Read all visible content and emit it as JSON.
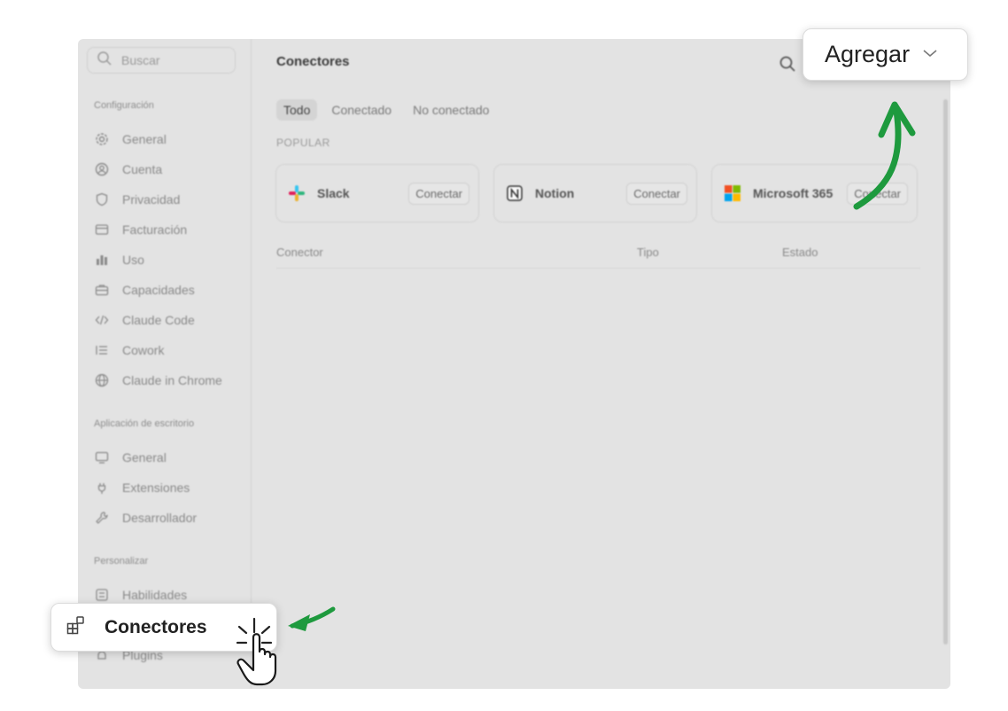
{
  "sidebar": {
    "search_placeholder": "Buscar",
    "sections": [
      {
        "label": "Configuración",
        "items": [
          {
            "label": "General",
            "icon": "gear-icon"
          },
          {
            "label": "Cuenta",
            "icon": "user-circle-icon"
          },
          {
            "label": "Privacidad",
            "icon": "shield-icon"
          },
          {
            "label": "Facturación",
            "icon": "credit-card-icon"
          },
          {
            "label": "Uso",
            "icon": "bar-chart-icon"
          },
          {
            "label": "Capacidades",
            "icon": "briefcase-icon"
          },
          {
            "label": "Claude Code",
            "icon": "code-icon"
          },
          {
            "label": "Cowork",
            "icon": "list-icon"
          },
          {
            "label": "Claude in Chrome",
            "icon": "globe-icon"
          }
        ]
      },
      {
        "label": "Aplicación de escritorio",
        "items": [
          {
            "label": "General",
            "icon": "monitor-icon"
          },
          {
            "label": "Extensiones",
            "icon": "plug-icon"
          },
          {
            "label": "Desarrollador",
            "icon": "wrench-icon"
          }
        ]
      },
      {
        "label": "Personalizar",
        "items": [
          {
            "label": "Habilidades",
            "icon": "skills-icon"
          },
          {
            "label": "Plugins",
            "icon": "plugin-icon"
          }
        ]
      }
    ]
  },
  "main": {
    "title": "Conectores",
    "tabs": [
      "Todo",
      "Conectado",
      "No conectado"
    ],
    "active_tab": "Todo",
    "popular_label": "POPULAR",
    "popular_cards": [
      {
        "name": "Slack",
        "button": "Conectar",
        "icon": "slack-logo-icon"
      },
      {
        "name": "Notion",
        "button": "Conectar",
        "icon": "notion-logo-icon"
      },
      {
        "name": "Microsoft 365",
        "button": "Conectar",
        "icon": "microsoft-logo-icon"
      }
    ],
    "table_columns": [
      "Conector",
      "Tipo",
      "Estado"
    ]
  },
  "highlights": {
    "add_button_label": "Agregar",
    "connectors_item_label": "Conectores"
  },
  "colors": {
    "annotation_arrow": "#1e9a3e",
    "window_bg": "#e3e3e3"
  }
}
